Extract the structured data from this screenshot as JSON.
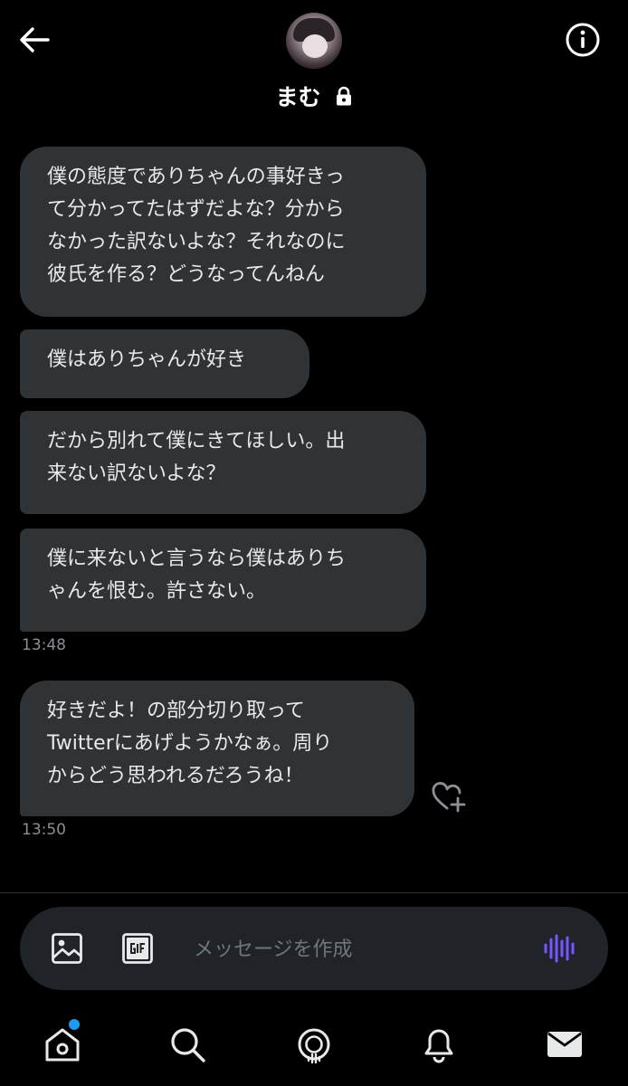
{
  "header": {
    "title": "まむ",
    "icons": {
      "back": "arrow-left-icon",
      "info": "info-circle-icon",
      "lock": "lock-icon"
    }
  },
  "messages": [
    {
      "text": "僕の態度でありちゃんの事好きっ\nて分かってたはずだよな？分から\nなかった訳ないよな？それなのに\n彼氏を作る？どうなってんねん"
    },
    {
      "text": "僕はありちゃんが好き"
    },
    {
      "text": "だから別れて僕にきてほしい。出\n来ない訳ないよな？"
    },
    {
      "text": "僕に来ないと言うなら僕はありち\nゃんを恨む。許さない。"
    },
    {
      "text": "好きだよ！の部分切り取って\nTwitterにあげようかなぁ。周り\nからどう思われるだろうね！"
    }
  ],
  "timestamps": [
    "13:48",
    "13:50"
  ],
  "composer": {
    "placeholder": "メッセージを作成",
    "icons": {
      "image": "image-icon",
      "gif": "gif-icon",
      "voice": "voice-waveform-icon"
    },
    "voice_color": "#7856ff"
  },
  "nav": {
    "items": [
      "home-icon",
      "search-icon",
      "spaces-icon",
      "notifications-icon",
      "messages-icon"
    ],
    "badge_color": "#1d9bf0"
  },
  "react_icon": "heart-plus-icon"
}
